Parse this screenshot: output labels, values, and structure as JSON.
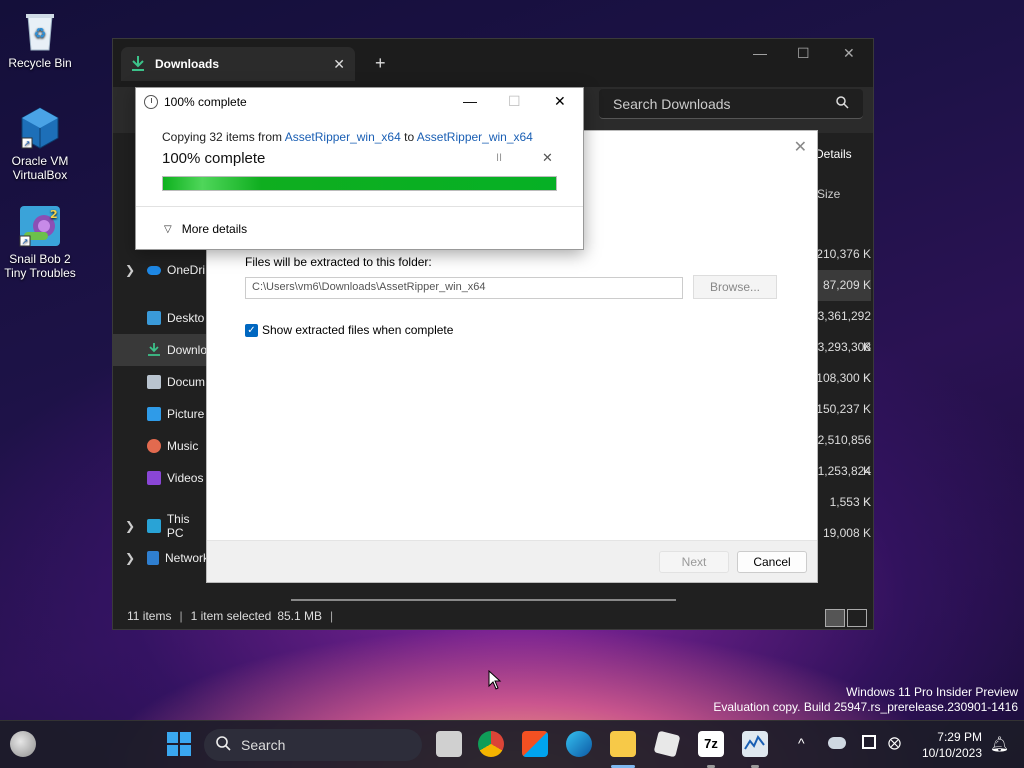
{
  "desktop": {
    "icons": [
      {
        "label_line1": "Recycle Bin",
        "label_line2": ""
      },
      {
        "label_line1": "Oracle VM",
        "label_line2": "VirtualBox"
      },
      {
        "label_line1": "Snail Bob 2",
        "label_line2": "Tiny Troubles"
      }
    ]
  },
  "explorer": {
    "tab_title": "Downloads",
    "tab_close": "✕",
    "new_tab": "+",
    "window_controls": {
      "minimize": "—",
      "maximize": "☐",
      "close": "✕"
    },
    "search_placeholder": "Search Downloads",
    "details_label": "Details",
    "size_header": "Size",
    "nav": [
      {
        "label": "OneDri",
        "icon": "onedrive-icon",
        "expandable": true
      },
      {
        "label": "Deskto",
        "icon": "desktop-folder-icon",
        "expandable": false
      },
      {
        "label": "Downlo",
        "icon": "downloads-icon",
        "expandable": false,
        "selected": true
      },
      {
        "label": "Docum",
        "icon": "documents-icon",
        "expandable": false
      },
      {
        "label": "Picture",
        "icon": "pictures-icon",
        "expandable": false
      },
      {
        "label": "Music",
        "icon": "music-icon",
        "expandable": false
      },
      {
        "label": "Videos",
        "icon": "videos-icon",
        "expandable": false
      },
      {
        "label": "This PC",
        "icon": "this-pc-icon",
        "expandable": true
      },
      {
        "label": "Network",
        "icon": "network-icon",
        "expandable": true
      }
    ],
    "sizes": [
      "210,376 K",
      "87,209 K",
      "3,361,292 K",
      "3,293,308 K",
      "108,300 K",
      "150,237 K",
      "2,510,856 K",
      "1,253,824 K",
      "1,553 K",
      "19,008 K"
    ],
    "status": {
      "items": "11 items",
      "sep": "|",
      "selected": "1 item selected",
      "size": "85.1 MB",
      "sep2": "|"
    }
  },
  "wizard": {
    "close": "✕",
    "folder_label": "Files will be extracted to this folder:",
    "path_value": "C:\\Users\\vm6\\Downloads\\AssetRipper_win_x64",
    "browse_label": "Browse...",
    "checkbox_label": "Show extracted files when complete",
    "checkbox_checked": true,
    "next_label": "Next",
    "cancel_label": "Cancel"
  },
  "copy_dialog": {
    "title": "100% complete",
    "controls": {
      "minimize": "—",
      "maximize": "☐",
      "close": "✕"
    },
    "line_prefix": "Copying 32 items from ",
    "source": "AssetRipper_win_x64",
    "line_mid": " to ",
    "dest": "AssetRipper_win_x64",
    "percent_text": "100% complete",
    "progress": 1.0,
    "pause_symbol": "II",
    "cancel_symbol": "✕",
    "more_details": "More details"
  },
  "watermark": {
    "line1": "Windows 11 Pro Insider Preview",
    "line2": "Evaluation copy. Build 25947.rs_prerelease.230901-1416"
  },
  "taskbar": {
    "search_label": "Search",
    "time": "7:29 PM",
    "date": "10/10/2023",
    "apps": [
      "start-icon",
      "task-view-icon",
      "chrome-icon",
      "store-icon",
      "edge-icon",
      "file-explorer-icon",
      "roblox-icon",
      "7zip-icon",
      "performance-monitor-icon"
    ],
    "accent": "#0067c0"
  }
}
